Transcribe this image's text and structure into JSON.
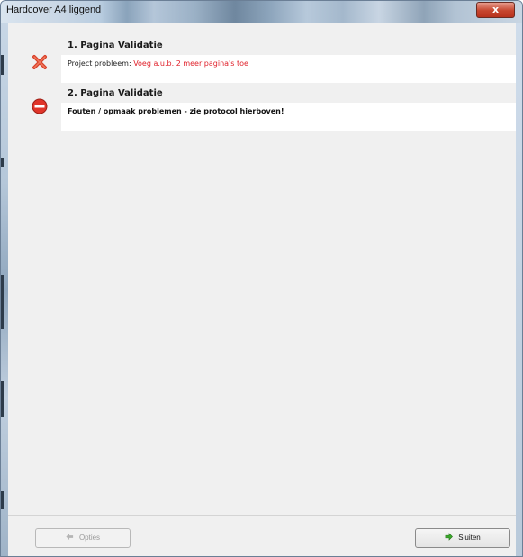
{
  "window": {
    "title": "Hardcover A4 liggend",
    "close_glyph": "x"
  },
  "sections": [
    {
      "icon": "red-x-icon",
      "title": "1. Pagina Validatie",
      "label": "Project probleem:",
      "value": "Voeg a.u.b. 2 meer pagina's toe"
    },
    {
      "icon": "stop-icon",
      "title": "2. Pagina Validatie",
      "text": "Fouten / opmaak problemen - zie protocol hierboven!"
    }
  ],
  "buttons": {
    "options_label": "Opties",
    "close_label": "Sluiten"
  },
  "colors": {
    "error_text": "#e0202a",
    "x_icon": "#d8402a",
    "stop_icon": "#e0352a",
    "go_arrow": "#3aa82a"
  }
}
